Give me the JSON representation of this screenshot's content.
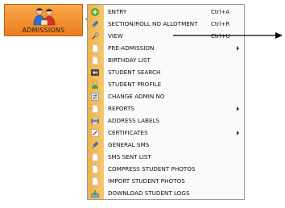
{
  "button": {
    "label": "ADMISSIONS",
    "icon": "students-icon"
  },
  "menu": {
    "items": [
      {
        "label": "ENTRY",
        "shortcut": "Ctrl+A",
        "icon": "add-icon",
        "submenu": false
      },
      {
        "label": "SECTION/ROLL NO ALLOTMENT",
        "shortcut": "Ctrl+R",
        "icon": "pencil-icon",
        "submenu": false
      },
      {
        "label": "VIEW",
        "shortcut": "Ctrl+U",
        "icon": "wrench-icon",
        "submenu": false
      },
      {
        "label": "PRE-ADMISSION",
        "shortcut": "",
        "icon": "document-icon",
        "submenu": true
      },
      {
        "label": "BIRTHDAY LIST",
        "shortcut": "",
        "icon": "document-icon",
        "submenu": false
      },
      {
        "label": "STUDENT SEARCH",
        "shortcut": "",
        "icon": "search-card-icon",
        "submenu": false
      },
      {
        "label": "STUDENT PROFILE",
        "shortcut": "",
        "icon": "profile-icon",
        "submenu": false
      },
      {
        "label": "CHANGE ADMIN NO",
        "shortcut": "",
        "icon": "change-icon",
        "submenu": false
      },
      {
        "label": "REPORTS",
        "shortcut": "",
        "icon": "document-icon",
        "submenu": true
      },
      {
        "label": "ADDRESS LABELS",
        "shortcut": "",
        "icon": "labels-icon",
        "submenu": false
      },
      {
        "label": "CERTIFICATES",
        "shortcut": "",
        "icon": "certificate-icon",
        "submenu": true
      },
      {
        "label": "GENERAL SMS",
        "shortcut": "",
        "icon": "sms-icon",
        "submenu": false
      },
      {
        "label": "SMS SENT LIST",
        "shortcut": "",
        "icon": "document-icon",
        "submenu": false
      },
      {
        "label": "COMPRESS STUDENT PHOTOS",
        "shortcut": "",
        "icon": "document-icon",
        "submenu": false
      },
      {
        "label": "IMPORT STUDENT PHOTOS",
        "shortcut": "",
        "icon": "document-icon",
        "submenu": false
      },
      {
        "label": "DOWNLOAD STUDENT LOGS",
        "shortcut": "",
        "icon": "download-icon",
        "submenu": false
      }
    ]
  },
  "colors": {
    "button_top": "#f8a94c",
    "button_bottom": "#ec7d1c",
    "menu_strip": "#f0b24a",
    "arrow": "#000000"
  }
}
